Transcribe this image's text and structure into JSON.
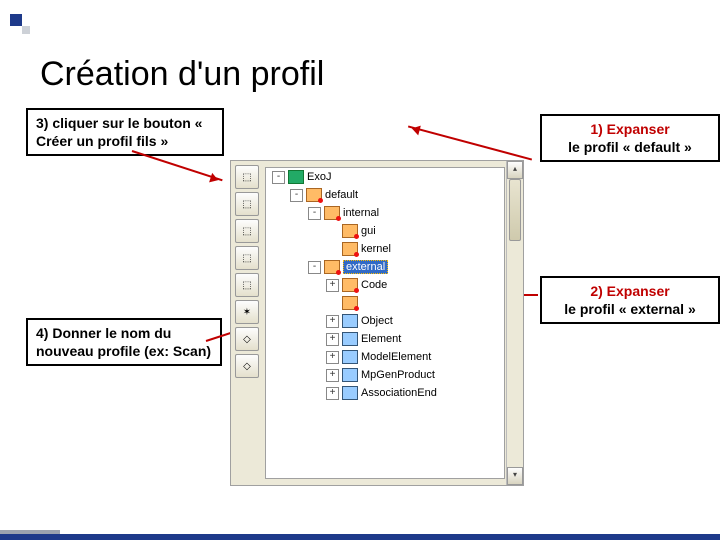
{
  "title": "Création d'un profil",
  "callouts": {
    "c3": "3) cliquer sur le bouton « Créer un profil fils »",
    "c1_l1": "1) Expanser",
    "c1_l2": "le profil « default »",
    "c2_l1": "2) Expanser",
    "c2_l2": "le profil « external »",
    "c4": "4) Donner le nom du nouveau profile (ex: Scan)"
  },
  "toolbar_icons": [
    "⬚",
    "⬚",
    "⬚",
    "⬚",
    "⬚",
    "✶",
    "◇",
    "◇"
  ],
  "tree": [
    {
      "indent": 0,
      "tw": "-",
      "type": "pkg",
      "label": "ExoJ"
    },
    {
      "indent": 1,
      "tw": "-",
      "type": "prof",
      "label": "default"
    },
    {
      "indent": 2,
      "tw": "-",
      "type": "prof",
      "label": "internal"
    },
    {
      "indent": 3,
      "tw": "",
      "type": "prof",
      "label": "gui"
    },
    {
      "indent": 3,
      "tw": "",
      "type": "prof",
      "label": "kernel"
    },
    {
      "indent": 2,
      "tw": "-",
      "type": "prof",
      "label": "external",
      "selected": true
    },
    {
      "indent": 3,
      "tw": "+",
      "type": "prof",
      "label": "Code"
    },
    {
      "indent": 3,
      "tw": "",
      "type": "prof",
      "label": ""
    },
    {
      "indent": 3,
      "tw": "+",
      "type": "cls",
      "label": "Object"
    },
    {
      "indent": 3,
      "tw": "+",
      "type": "cls",
      "label": "Element"
    },
    {
      "indent": 3,
      "tw": "+",
      "type": "cls",
      "label": "ModelElement"
    },
    {
      "indent": 3,
      "tw": "+",
      "type": "cls",
      "label": "MpGenProduct"
    },
    {
      "indent": 3,
      "tw": "+",
      "type": "cls",
      "label": "AssociationEnd"
    }
  ]
}
